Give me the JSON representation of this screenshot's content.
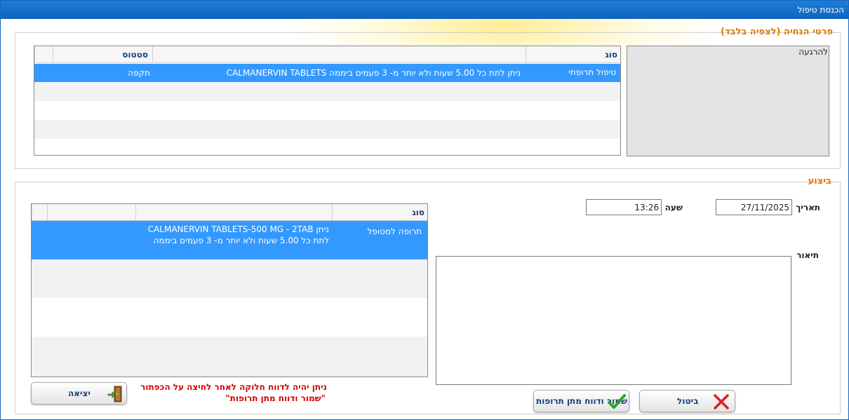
{
  "window": {
    "title": "הכנסת טיפול"
  },
  "instructions_section": {
    "legend": "פרטי הנחיה (לצפיה בלבד)",
    "columns": [
      "סוג",
      "",
      "סטטוס",
      ""
    ],
    "rows": [
      {
        "type": "טיפול תרופתי",
        "description": "ניתן לתת כל 5.00 שעות ולא יותר מ- 3 פעמים ביממה CALMANERVIN TABLETS",
        "status": "תקפה"
      }
    ],
    "side_text": "להרגעה"
  },
  "execution_section": {
    "legend": "ביצוע",
    "date_label": "תאריך",
    "date_value": "27/11/2025",
    "time_label": "שעה",
    "time_value": "13:26",
    "description_label": "תיאור",
    "description_value": "",
    "grid": {
      "columns": [
        "סוג",
        "",
        "",
        ""
      ],
      "rows": [
        {
          "type": "תרופה למטופל",
          "line1": "ניתן CALMANERVIN TABLETS-500 MG - 2TAB",
          "line2": "לתת כל 5.00 שעות ולא יותר מ- 3 פעמים ביממה"
        }
      ]
    },
    "note_line1": "ניתן יהיה לדווח חלוקה לאחר לחיצה על הכפתור",
    "note_line2": "\"שמור ודווח מתן תרופות\""
  },
  "buttons": {
    "exit": "יציאה",
    "save_report": "שמור ודווח מתן תרופות",
    "cancel": "ביטול"
  },
  "colors": {
    "title_bar": "#1565c0",
    "selection": "#3399ff",
    "legend": "#e57a00",
    "note": "#d40000",
    "header_text": "#1a3f7a"
  }
}
